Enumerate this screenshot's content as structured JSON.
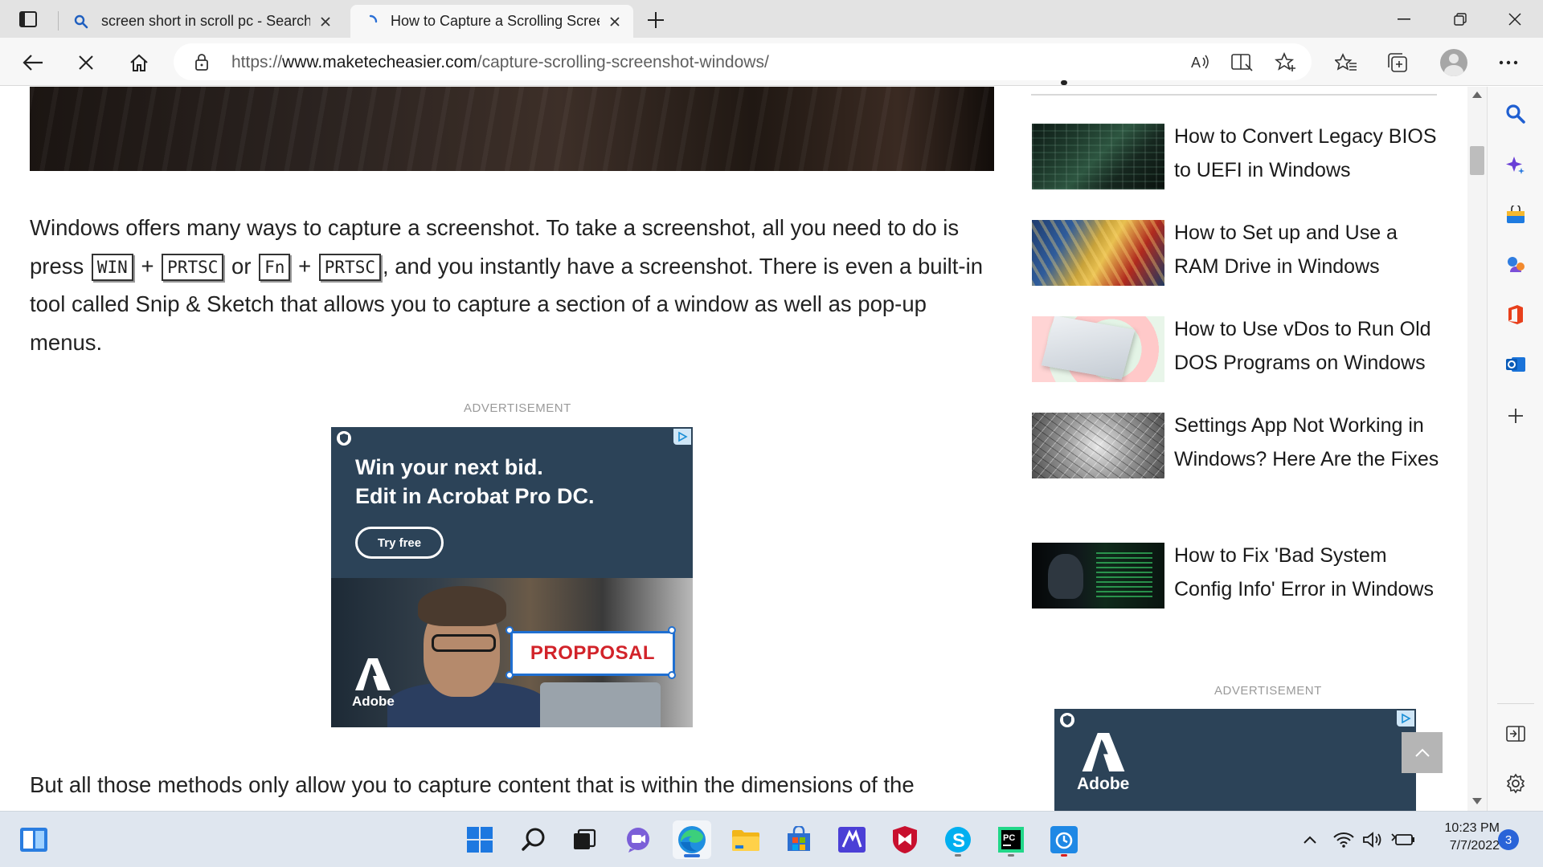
{
  "browser": {
    "tabs": [
      {
        "title": "screen short in scroll pc - Search",
        "icon": "search-icon",
        "active": false
      },
      {
        "title": "How to Capture a Scrolling Screenshot in Windows",
        "icon": "loading-icon",
        "active": true
      }
    ],
    "address": {
      "scheme": "https://",
      "host": "www.maketecheasier.com",
      "path": "/capture-scrolling-screenshot-windows/"
    }
  },
  "article": {
    "para1_part1": "Windows offers many ways to capture a screenshot. To take a screenshot, all you need to do is press",
    "keys": {
      "win": "WIN",
      "prtsc": "PRTSC",
      "fn": "Fn",
      "prtsc2": "PRTSC"
    },
    "plus": "+",
    "or": "or",
    "para1_part2": ", and you instantly have a screenshot. There is even a built-in tool called Snip & Sketch that allows you to capture a section of a window as well as pop-up menus.",
    "para2": "But all those methods only allow you to capture content that is within the dimensions of the"
  },
  "ads": {
    "label": "ADVERTISEMENT",
    "main": {
      "headline_1": "Win your next bid.",
      "headline_2": "Edit in Acrobat Pro DC.",
      "cta": "Try free",
      "proposal_text": "PROPPOSAL",
      "brand": "Adobe"
    },
    "side": {
      "brand": "Adobe"
    }
  },
  "related": [
    {
      "title": "How to Convert Legacy BIOS to UEFI in Windows"
    },
    {
      "title": "How to Set up and Use a RAM Drive in Windows"
    },
    {
      "title": "How to Use vDos to Run Old DOS Programs on Windows"
    },
    {
      "title": "Settings App Not Working in Windows? Here Are the Fixes"
    },
    {
      "title": "How to Fix 'Bad System Config Info' Error in Windows"
    }
  ],
  "taskbar": {
    "time": "10:23 PM",
    "date": "7/7/2022",
    "notifications": "3"
  },
  "colors": {
    "ad_background": "#2c4358",
    "edge_accent": "#2a6fd6",
    "taskbar": "#dfe6ef"
  }
}
